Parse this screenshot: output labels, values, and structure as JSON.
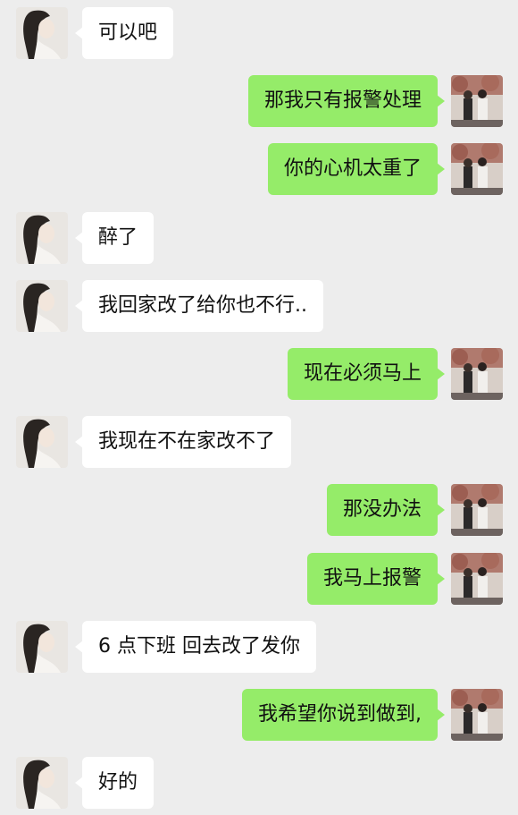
{
  "colors": {
    "background": "#ededed",
    "sent_bubble": "#95ec69",
    "received_bubble": "#ffffff"
  },
  "avatars": {
    "contact": "contact-avatar-long-hair-photo",
    "self": "self-avatar-two-people-photo"
  },
  "messages": [
    {
      "side": "left",
      "text": "可以吧"
    },
    {
      "side": "right",
      "text": "那我只有报警处理"
    },
    {
      "side": "right",
      "text": "你的心机太重了"
    },
    {
      "side": "left",
      "text": "醉了"
    },
    {
      "side": "left",
      "text": "我回家改了给你也不行.."
    },
    {
      "side": "right",
      "text": "现在必须马上"
    },
    {
      "side": "left",
      "text": "我现在不在家改不了"
    },
    {
      "side": "right",
      "text": "那没办法"
    },
    {
      "side": "right",
      "text": "我马上报警"
    },
    {
      "side": "left",
      "text": "6 点下班 回去改了发你"
    },
    {
      "side": "right",
      "text": "我希望你说到做到,"
    },
    {
      "side": "left",
      "text": "好的"
    }
  ]
}
